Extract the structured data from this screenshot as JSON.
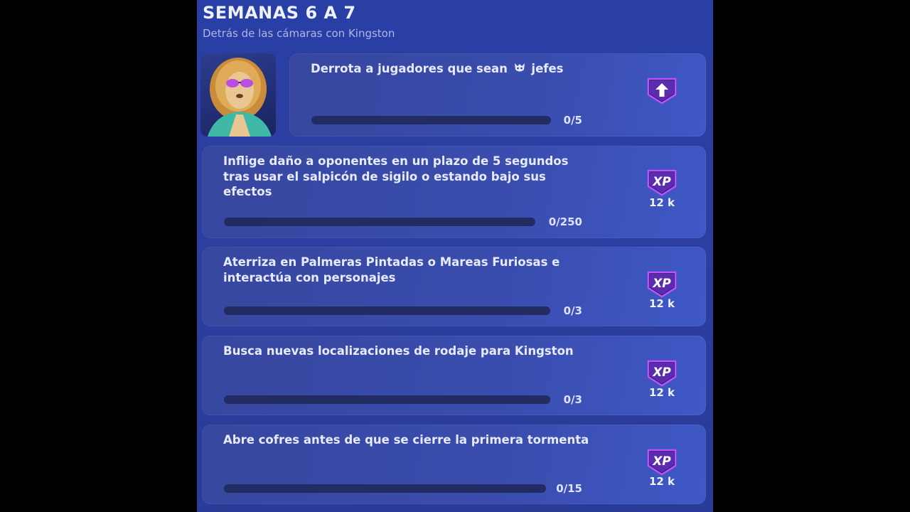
{
  "header": {
    "title": "SEMANAS 6 A 7",
    "subtitle": "Detrás de las cámaras con Kingston"
  },
  "quests": [
    {
      "text_before_icon": "Derrota a jugadores que sean",
      "inline_icon": "boss-icon",
      "text_after_icon": "jefes",
      "progress": "0/5",
      "progress_value": 0,
      "reward_icon": "upgrade-arrow-icon",
      "reward_amount": ""
    },
    {
      "text": "Inflige daño a oponentes en un plazo de 5 segundos tras usar el salpicón de sigilo o estando bajo sus efectos",
      "progress": "0/250",
      "progress_value": 0,
      "reward_icon": "xp-icon",
      "reward_label": "XP",
      "reward_amount": "12 k"
    },
    {
      "text": "Aterriza en Palmeras Pintadas o Mareas Furiosas e interactúa con personajes",
      "progress": "0/3",
      "progress_value": 0,
      "reward_icon": "xp-icon",
      "reward_label": "XP",
      "reward_amount": "12 k"
    },
    {
      "text": "Busca nuevas localizaciones de rodaje para Kingston",
      "progress": "0/3",
      "progress_value": 0,
      "reward_icon": "xp-icon",
      "reward_label": "XP",
      "reward_amount": "12 k"
    },
    {
      "text": "Abre cofres antes de que se cierre la primera tormenta",
      "progress": "0/15",
      "progress_value": 0,
      "reward_icon": "xp-icon",
      "reward_label": "XP",
      "reward_amount": "12 k"
    }
  ],
  "colors": {
    "panel_bg": "#2a3fa6",
    "card_bg": "#3a4dae",
    "progress_track": "#222b62",
    "reward_badge": "#7b2fd6"
  }
}
